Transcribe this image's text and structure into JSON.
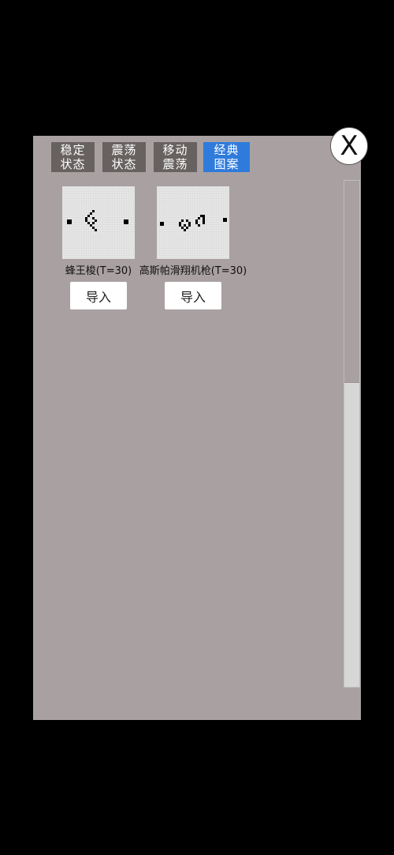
{
  "tabs": [
    {
      "line1": "稳定",
      "line2": "状态",
      "active": false
    },
    {
      "line1": "震荡",
      "line2": "状态",
      "active": false
    },
    {
      "line1": "移动",
      "line2": "震荡",
      "active": false
    },
    {
      "line1": "经典",
      "line2": "图案",
      "active": true
    }
  ],
  "close_label": "X",
  "patterns": [
    {
      "name": "蜂王梭(T=30)",
      "import_label": "导入"
    },
    {
      "name": "高斯帕滑翔机枪(T=30)",
      "import_label": "导入"
    }
  ],
  "colors": {
    "panel": "#a9a1a1",
    "tab": "#676160",
    "tab_active": "#2f7bdc",
    "cell": "#000000",
    "grid_bg": "#e6e6e6"
  }
}
